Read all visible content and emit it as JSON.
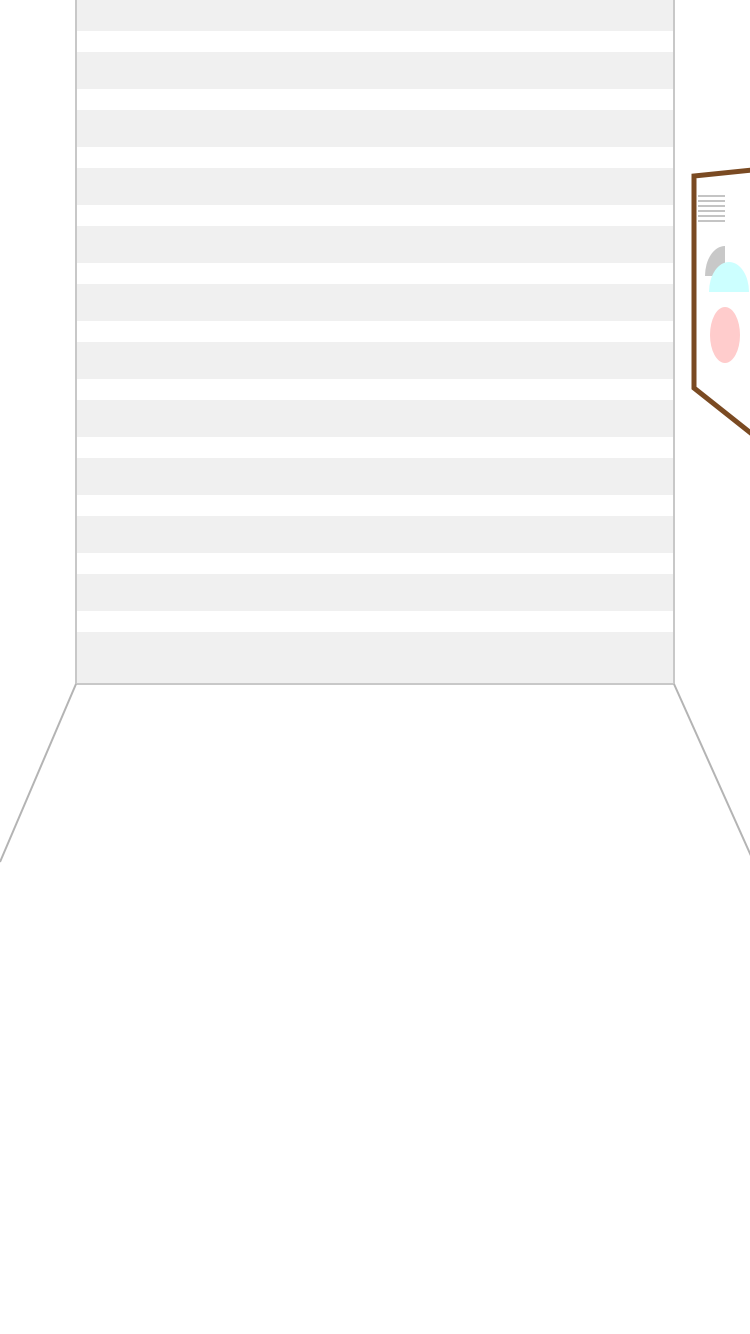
{
  "scene": {
    "type": "room-corner-view",
    "back_wall": {
      "stripe_count": 12,
      "stripe_color": "#f0f0f0",
      "wall_color": "#ffffff",
      "edge_color": "#c8c8c8"
    },
    "floor": {
      "color": "#ffffff",
      "edge_color": "#b4b4b4"
    },
    "right_wall_panel": {
      "frame_color": "#7a4a22",
      "fill_color": "#ffffff",
      "items": [
        {
          "name": "text-lines-icon",
          "color": "#b0b0b0"
        },
        {
          "name": "gray-half-circle-icon",
          "color": "#c8c8c8"
        },
        {
          "name": "cyan-half-circle-icon",
          "color": "#ccffff"
        },
        {
          "name": "pink-oval-icon",
          "color": "#ffcccc"
        }
      ]
    }
  }
}
